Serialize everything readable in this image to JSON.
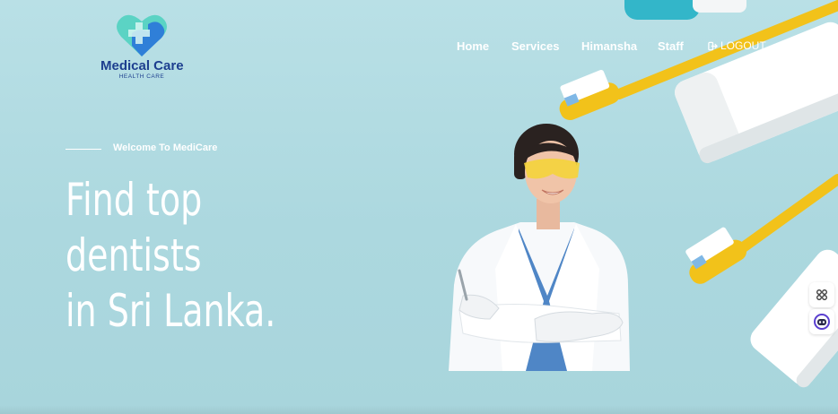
{
  "brand": {
    "name": "Medical Care",
    "tagline": "HEALTH CARE",
    "colors": {
      "heart_teal": "#5bd3c4",
      "heart_blue": "#2f7fd8",
      "text_navy": "#1d3f8f"
    }
  },
  "nav": {
    "items": [
      {
        "label": "Home"
      },
      {
        "label": "Services"
      },
      {
        "label": "Himansha"
      },
      {
        "label": "Staff"
      }
    ],
    "logout": {
      "label": "LOGOUT",
      "icon": "logout-icon"
    }
  },
  "hero": {
    "welcome": "Welcome To MediCare",
    "headline": [
      "Find top",
      "dentists",
      "in Sri Lanka."
    ],
    "background_color": "#b3dce3",
    "accent_yellow": "#f2c21a"
  },
  "side_widgets": [
    {
      "icon": "apps-grid-icon"
    },
    {
      "icon": "assistant-robot-icon"
    }
  ]
}
